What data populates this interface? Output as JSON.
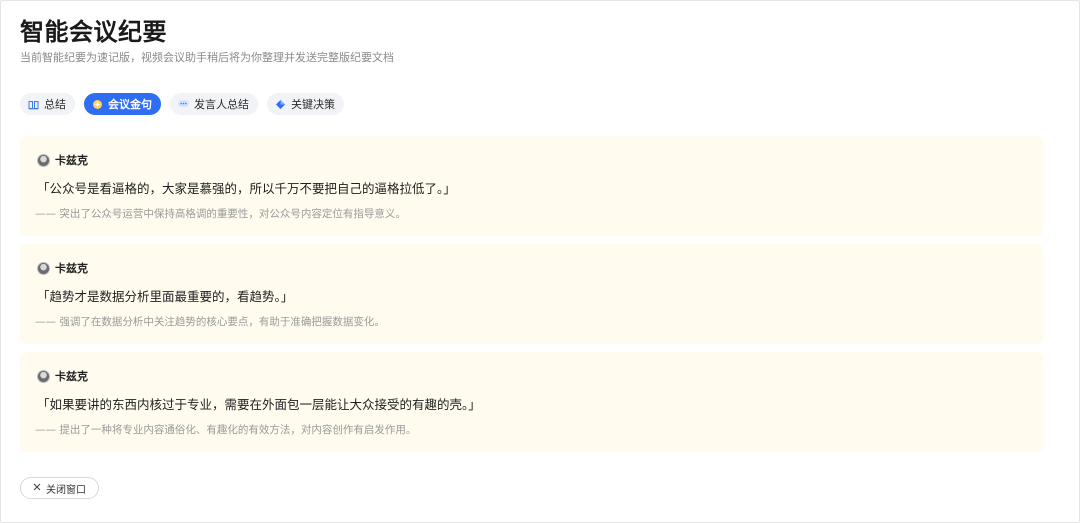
{
  "header": {
    "title": "智能会议纪要",
    "subtitle": "当前智能纪要为速记版，视频会议助手稍后将为你整理并发送完整版纪要文档"
  },
  "tabs": [
    {
      "label": "总结",
      "icon": "book-icon",
      "active": false
    },
    {
      "label": "会议金句",
      "icon": "sparkle-icon",
      "active": true
    },
    {
      "label": "发言人总结",
      "icon": "speech-bubble-icon",
      "active": false
    },
    {
      "label": "关键决策",
      "icon": "diamond-icon",
      "active": false
    }
  ],
  "quotes": [
    {
      "speaker": "卡兹克",
      "quote": "「公众号是看逼格的，大家是慕强的，所以千万不要把自己的逼格拉低了。」",
      "note": "—— 突出了公众号运营中保持高格调的重要性，对公众号内容定位有指导意义。"
    },
    {
      "speaker": "卡兹克",
      "quote": "「趋势才是数据分析里面最重要的，看趋势。」",
      "note": "—— 强调了在数据分析中关注趋势的核心要点，有助于准确把握数据变化。"
    },
    {
      "speaker": "卡兹克",
      "quote": "「如果要讲的东西内核过于专业，需要在外面包一层能让大众接受的有趣的壳。」",
      "note": "—— 提出了一种将专业内容通俗化、有趣化的有效方法，对内容创作有启发作用。"
    }
  ],
  "footer": {
    "close_label": "关闭窗口",
    "close_icon": "close-icon"
  },
  "colors": {
    "accent": "#2f6df3",
    "card_bg": "#fffbef",
    "tab_bg": "#f1f3f6"
  }
}
